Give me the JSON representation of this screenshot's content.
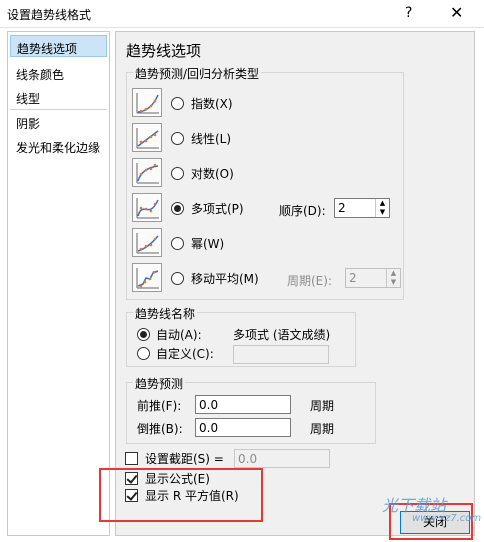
{
  "window": {
    "title": "设置趋势线格式",
    "help": "?",
    "close": "✕"
  },
  "nav": {
    "items": [
      {
        "label": "趋势线选项",
        "selected": true
      },
      {
        "label": "线条颜色"
      },
      {
        "label": "线型"
      },
      {
        "label": "阴影"
      },
      {
        "label": "发光和柔化边缘"
      }
    ]
  },
  "panel": {
    "title": "趋势线选项",
    "regression": {
      "group_title": "趋势预测/回归分析类型",
      "types": [
        {
          "label": "指数(X)",
          "icon": "exponential-trend-icon",
          "checked": false
        },
        {
          "label": "线性(L)",
          "icon": "linear-trend-icon",
          "checked": false
        },
        {
          "label": "对数(O)",
          "icon": "logarithmic-trend-icon",
          "checked": false
        },
        {
          "label": "多项式(P)",
          "icon": "polynomial-trend-icon",
          "checked": true
        },
        {
          "label": "幂(W)",
          "icon": "power-trend-icon",
          "checked": false
        },
        {
          "label": "移动平均(M)",
          "icon": "moving-average-trend-icon",
          "checked": false
        }
      ],
      "order_label": "顺序(D):",
      "order_value": "2",
      "period_label": "周期(E):",
      "period_value": "2"
    },
    "name": {
      "group_title": "趋势线名称",
      "auto_label": "自动(A):",
      "auto_value": "多项式 (语文成绩)",
      "custom_label": "自定义(C):"
    },
    "forecast": {
      "group_title": "趋势预测",
      "forward_label": "前推(F):",
      "forward_value": "0.0",
      "backward_label": "倒推(B):",
      "backward_value": "0.0",
      "unit": "周期"
    },
    "intercept": {
      "label": "设置截距(S) =",
      "value": "0.0",
      "checked": false
    },
    "show_equation": {
      "label": "显示公式(E)",
      "checked": true
    },
    "show_r2": {
      "label": "显示 R 平方值(R)",
      "checked": true
    }
  },
  "close_button": "关闭",
  "watermark": {
    "brand": "光下载站",
    "url": "www.xz7.com"
  },
  "colors": {
    "highlight": "#e53935",
    "selected_nav": "#cce4f7",
    "accent": "#0078d7"
  }
}
